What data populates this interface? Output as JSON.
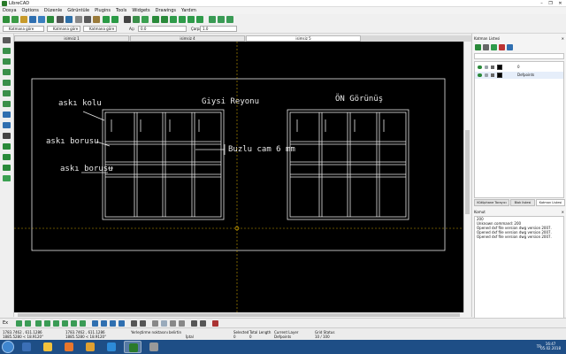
{
  "window": {
    "title": "LibreCAD",
    "controls": [
      "–",
      "❐",
      "✕"
    ]
  },
  "menu": [
    "Dosya",
    "Options",
    "Düzenle",
    "Görüntüle",
    "Plugins",
    "Tools",
    "Widgets",
    "Drawings",
    "Yardım"
  ],
  "props": {
    "pen1": "Katmana göre",
    "pen2": "Katmana göre",
    "pen3": "Katmana göre",
    "angle_label": "Açı",
    "angle_value": "0.0",
    "scale_label": "Çarpan",
    "scale_value": "1.0"
  },
  "tabs": [
    {
      "label": "isimsiz 1",
      "active": false
    },
    {
      "label": "isimsiz 4",
      "active": false
    },
    {
      "label": "isimsiz 5",
      "active": true
    }
  ],
  "drawing": {
    "title1": "Giysi Reyonu",
    "title2": "ÖN Görünüş",
    "label1": "askı kolu",
    "label2": "askı borusu",
    "label3": "askı borusu",
    "label4": "Buzlu cam 6 mm"
  },
  "right_panel": {
    "layer_title": "Katman Listesi",
    "close": "✕",
    "layers": [
      {
        "name": "0",
        "color": "#000000"
      },
      {
        "name": "Defpoints",
        "color": "#000000"
      }
    ],
    "tabs": [
      "Kütüphane Tarayıcı",
      "Blok listesi",
      "Katman Listesi"
    ],
    "command_title": "Komut",
    "history": [
      "200",
      "Unknown command: 200",
      "Opened dxf file version dwg version 2007.",
      "Opened dxf file version dwg version 2007.",
      "Opened dxf file version dwg version 2007."
    ],
    "prompt": "Yerleştirme noktasını belirtin"
  },
  "snapbar": {
    "label": "Ex"
  },
  "status": {
    "coord1a": "1783.7462 , 611.1286",
    "coord1b": "1885.5280 < 18.9120°",
    "coord2a": "1783.7462 , 611.1286",
    "coord2b": "1885.5280 < 18.9120°",
    "hint": "Yerleştirme noktasını belirtin",
    "hint2": "İptal",
    "sel_label": "Selected",
    "sel_value": "0",
    "total_label": "Total Length",
    "total_value": "0",
    "layer_label": "Current Layer",
    "layer_value": "Defpoints",
    "grid_label": "Grid Status",
    "grid_value": "10 / 100"
  },
  "taskbar": {
    "language": "TR",
    "time": "16:47",
    "date": "05.02.2018"
  }
}
